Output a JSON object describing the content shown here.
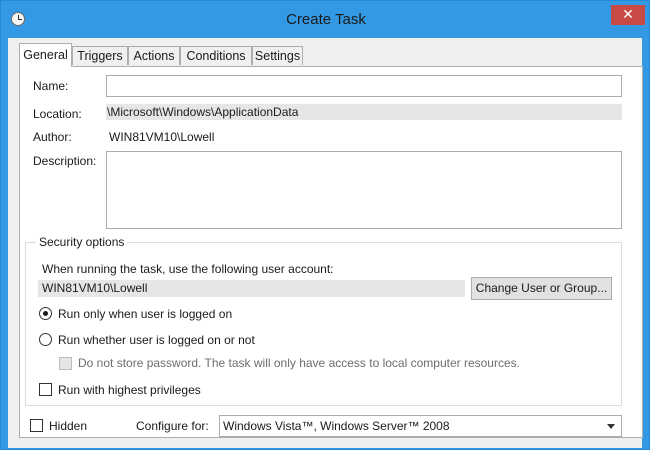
{
  "window": {
    "title": "Create Task",
    "close_glyph": "✕",
    "icons": {
      "app": "clock-icon",
      "close": "close-icon"
    }
  },
  "tabs": [
    {
      "label": "General",
      "active": true
    },
    {
      "label": "Triggers",
      "active": false
    },
    {
      "label": "Actions",
      "active": false
    },
    {
      "label": "Conditions",
      "active": false
    },
    {
      "label": "Settings",
      "active": false
    }
  ],
  "general": {
    "name_label": "Name:",
    "name_value": "",
    "location_label": "Location:",
    "location_value": "\\Microsoft\\Windows\\ApplicationData",
    "author_label": "Author:",
    "author_value": "WIN81VM10\\Lowell",
    "description_label": "Description:",
    "description_value": ""
  },
  "security": {
    "group_title": "Security options",
    "account_prompt": "When running the task, use the following user account:",
    "account_value": "WIN81VM10\\Lowell",
    "change_button": "Change User or Group...",
    "radio_logged_on": {
      "label": "Run only when user is logged on",
      "checked": true
    },
    "radio_whether": {
      "label": "Run whether user is logged on or not",
      "checked": false
    },
    "no_store_password": {
      "label": "Do not store password.  The task will only have access to local computer resources.",
      "checked": false,
      "enabled": false
    },
    "highest_privileges": {
      "label": "Run with highest privileges",
      "checked": false
    }
  },
  "footer": {
    "hidden": {
      "label": "Hidden",
      "checked": false
    },
    "configure_label": "Configure for:",
    "configure_value": "Windows Vista™, Windows Server™ 2008"
  },
  "colors": {
    "titlebar": "#3399e5",
    "close_button": "#c74a45",
    "dialog_background": "#f0f0f0",
    "panel_background": "#ffffff",
    "readonly_background": "#e6e6e6"
  }
}
